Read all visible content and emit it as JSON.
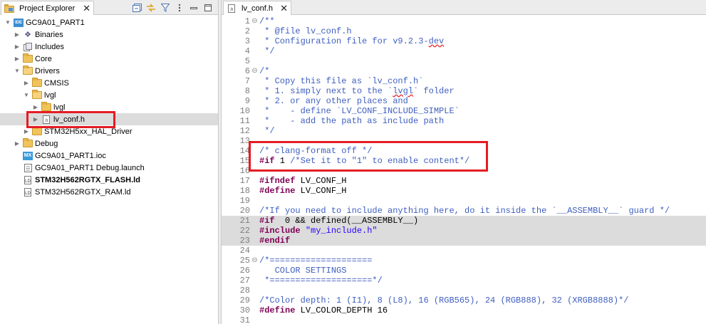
{
  "explorer": {
    "tab_label": "Project Explorer",
    "tab_close": "✕",
    "toolbar": {
      "collapse_icon": "collapse-all-icon",
      "link_icon": "link-with-editor-icon",
      "filter_icon": "filter-icon",
      "menu_icon": "view-menu-icon",
      "minimize_icon": "minimize-icon",
      "maximize_icon": "maximize-icon"
    },
    "tree": [
      {
        "label": "GC9A01_PART1",
        "icon": "ide-project-icon",
        "expanded": true
      },
      {
        "label": "Binaries",
        "icon": "binaries-icon",
        "expanded": false
      },
      {
        "label": "Includes",
        "icon": "includes-icon",
        "expanded": false
      },
      {
        "label": "Core",
        "icon": "folder-icon",
        "expanded": false
      },
      {
        "label": "Drivers",
        "icon": "folder-open-icon",
        "expanded": true
      },
      {
        "label": "CMSIS",
        "icon": "folder-icon",
        "expanded": false
      },
      {
        "label": "lvgl",
        "icon": "folder-open-icon",
        "expanded": true
      },
      {
        "label": "lvgl",
        "icon": "folder-icon",
        "expanded": false
      },
      {
        "label": "lv_conf.h",
        "icon": "header-file-icon",
        "expanded": false,
        "selected": true
      },
      {
        "label": "STM32H5xx_HAL_Driver",
        "icon": "folder-icon",
        "expanded": false
      },
      {
        "label": "Debug",
        "icon": "folder-icon",
        "expanded": false
      },
      {
        "label": "GC9A01_PART1.ioc",
        "icon": "mx-file-icon"
      },
      {
        "label": "GC9A01_PART1 Debug.launch",
        "icon": "launch-file-icon"
      },
      {
        "label": "STM32H562RGTX_FLASH.ld",
        "icon": "linker-file-icon",
        "bold": true
      },
      {
        "label": "STM32H562RGTX_RAM.ld",
        "icon": "linker-file-icon"
      }
    ]
  },
  "editor": {
    "tab_label": "lv_conf.h",
    "tab_close": "✕",
    "lines": [
      {
        "n": "1",
        "fold": "⊖",
        "parts": [
          {
            "t": "/**",
            "c": "comment"
          }
        ]
      },
      {
        "n": "2",
        "parts": [
          {
            "t": " * @file lv_conf.h",
            "c": "comment"
          }
        ]
      },
      {
        "n": "3",
        "parts": [
          {
            "t": " * Configuration file for v9.2.3-",
            "c": "comment"
          },
          {
            "t": "dev",
            "c": "comment squiggle"
          }
        ]
      },
      {
        "n": "4",
        "parts": [
          {
            "t": " */",
            "c": "comment"
          }
        ]
      },
      {
        "n": "5",
        "parts": []
      },
      {
        "n": "6",
        "fold": "⊖",
        "parts": [
          {
            "t": "/*",
            "c": "comment"
          }
        ]
      },
      {
        "n": "7",
        "parts": [
          {
            "t": " * Copy this file as `lv_conf.h`",
            "c": "comment"
          }
        ]
      },
      {
        "n": "8",
        "parts": [
          {
            "t": " * 1. simply next to the `",
            "c": "comment"
          },
          {
            "t": "lvgl",
            "c": "comment squiggle"
          },
          {
            "t": "` folder",
            "c": "comment"
          }
        ]
      },
      {
        "n": "9",
        "parts": [
          {
            "t": " * 2. or any other places and",
            "c": "comment"
          }
        ]
      },
      {
        "n": "10",
        "parts": [
          {
            "t": " *    - define `LV_CONF_INCLUDE_SIMPLE`",
            "c": "comment"
          }
        ]
      },
      {
        "n": "11",
        "parts": [
          {
            "t": " *    - add the path as include path",
            "c": "comment"
          }
        ]
      },
      {
        "n": "12",
        "parts": [
          {
            "t": " */",
            "c": "comment"
          }
        ]
      },
      {
        "n": "13",
        "parts": []
      },
      {
        "n": "14",
        "parts": [
          {
            "t": "/* clang-format off */",
            "c": "comment"
          }
        ]
      },
      {
        "n": "15",
        "parts": [
          {
            "t": "#if",
            "c": "kw"
          },
          {
            "t": " 1 ",
            "c": "plain"
          },
          {
            "t": "/*Set it to \"1\" to enable content*/",
            "c": "comment"
          }
        ]
      },
      {
        "n": "16",
        "parts": []
      },
      {
        "n": "17",
        "parts": [
          {
            "t": "#ifndef",
            "c": "kw"
          },
          {
            "t": " LV_CONF_H",
            "c": "plain"
          }
        ]
      },
      {
        "n": "18",
        "parts": [
          {
            "t": "#define",
            "c": "kw"
          },
          {
            "t": " LV_CONF_H",
            "c": "plain"
          }
        ]
      },
      {
        "n": "19",
        "parts": []
      },
      {
        "n": "20",
        "parts": [
          {
            "t": "/*If you need to include anything here, do it inside the `__ASSEMBLY__` guard */",
            "c": "comment"
          }
        ]
      },
      {
        "n": "21",
        "hl": true,
        "parts": [
          {
            "t": "#if",
            "c": "kw"
          },
          {
            "t": "  0 && defined(__ASSEMBLY__)",
            "c": "plain"
          }
        ]
      },
      {
        "n": "22",
        "hl": true,
        "parts": [
          {
            "t": "#include",
            "c": "kw"
          },
          {
            "t": " ",
            "c": "plain"
          },
          {
            "t": "\"my_include.h\"",
            "c": "str"
          }
        ]
      },
      {
        "n": "23",
        "hl": true,
        "parts": [
          {
            "t": "#endif",
            "c": "kw"
          }
        ]
      },
      {
        "n": "24",
        "parts": []
      },
      {
        "n": "25",
        "fold": "⊖",
        "parts": [
          {
            "t": "/*====================",
            "c": "comment"
          }
        ]
      },
      {
        "n": "26",
        "parts": [
          {
            "t": "   COLOR SETTINGS",
            "c": "comment"
          }
        ]
      },
      {
        "n": "27",
        "parts": [
          {
            "t": " *====================*/",
            "c": "comment"
          }
        ]
      },
      {
        "n": "28",
        "parts": []
      },
      {
        "n": "29",
        "parts": [
          {
            "t": "/*Color depth: 1 (I1), 8 (L8), 16 (RGB565), 24 (RGB888), 32 (XRGB8888)*/",
            "c": "comment"
          }
        ]
      },
      {
        "n": "30",
        "parts": [
          {
            "t": "#define",
            "c": "kw"
          },
          {
            "t": " LV_COLOR_DEPTH 16",
            "c": "plain"
          }
        ]
      },
      {
        "n": "31",
        "parts": []
      }
    ]
  },
  "colors": {
    "highlight_box": "#e51c23",
    "comment": "#3f5fbf",
    "keyword": "#7f0055",
    "string": "#2a00ff"
  }
}
